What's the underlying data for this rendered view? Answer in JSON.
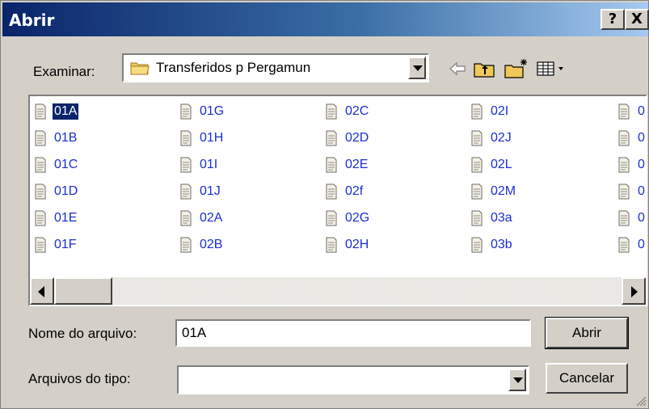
{
  "title": "Abrir",
  "titlebar_buttons": {
    "help": "?",
    "close": "X"
  },
  "look_in": {
    "label": "Examinar:",
    "value": "Transferidos p Pergamun",
    "folder_icon": "folder-icon"
  },
  "toolbar": {
    "icons": [
      "back-arrow-icon",
      "up-folder-icon",
      "new-folder-icon",
      "views-menu-icon"
    ]
  },
  "file_list": {
    "columns": [
      [
        "01A",
        "01B",
        "01C",
        "01D",
        "01E",
        "01F"
      ],
      [
        "01G",
        "01H",
        "01I",
        "01J",
        "02A",
        "02B"
      ],
      [
        "02C",
        "02D",
        "02E",
        "02f",
        "02G",
        "02H"
      ],
      [
        "02I",
        "02J",
        "02L",
        "02M",
        "03a",
        "03b"
      ],
      [
        "0",
        "0",
        "0",
        "0",
        "0",
        "0"
      ]
    ],
    "selected": "01A",
    "item_icon": "text-document-icon"
  },
  "file_name": {
    "label": "Nome do arquivo:",
    "value": "01A"
  },
  "file_type": {
    "label": "Arquivos do tipo:",
    "value": ""
  },
  "buttons": {
    "open": "Abrir",
    "cancel": "Cancelar"
  },
  "colors": {
    "title_gradient_start": "#0a246a",
    "title_gradient_end": "#a6caf0",
    "selection": "#0a246a",
    "file_text": "#1a2fd0",
    "dialog_face": "#d4d0c8"
  }
}
